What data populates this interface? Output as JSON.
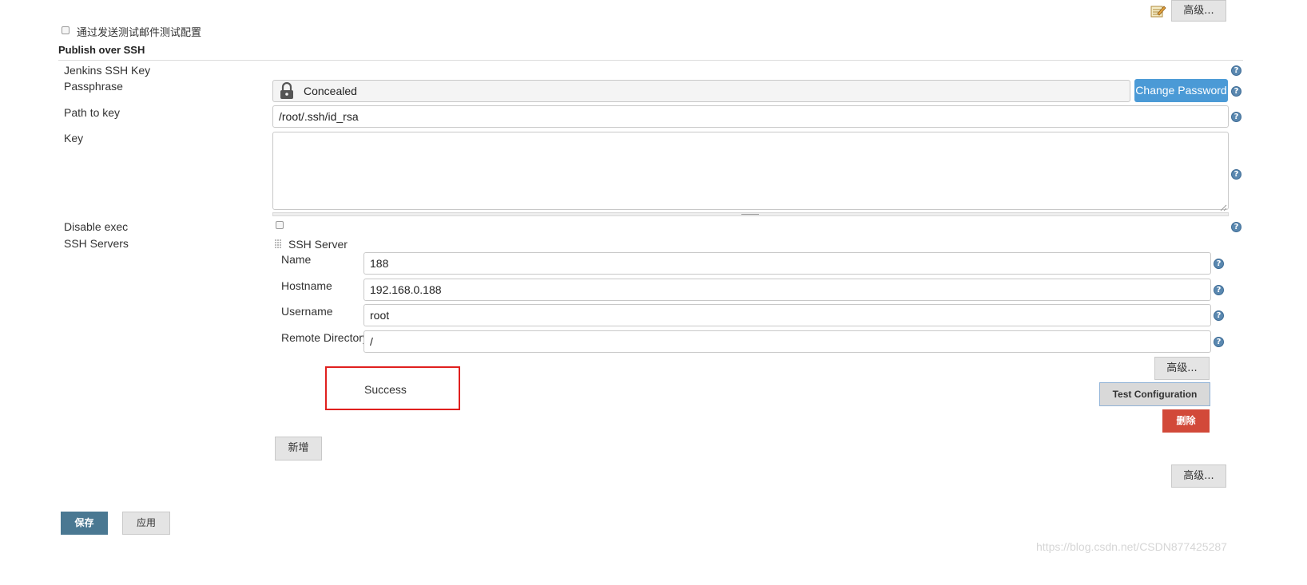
{
  "top": {
    "advanced_label": "高级..."
  },
  "email_test": {
    "checkbox_label": "通过发送测试邮件测试配置"
  },
  "section": {
    "title": "Publish over SSH"
  },
  "ssh": {
    "jenkins_key_label": "Jenkins SSH Key",
    "passphrase_label": "Passphrase",
    "passphrase_value": "Concealed",
    "change_password_label": "Change Password",
    "path_label": "Path to key",
    "path_value": "/root/.ssh/id_rsa",
    "key_label": "Key",
    "key_value": "",
    "disable_exec_label": "Disable exec",
    "servers_label": "SSH Servers"
  },
  "server": {
    "heading": "SSH Server",
    "name_label": "Name",
    "name_value": "188",
    "hostname_label": "Hostname",
    "hostname_value": "192.168.0.188",
    "username_label": "Username",
    "username_value": "root",
    "remote_dir_label": "Remote Directory",
    "remote_dir_value": "/",
    "advanced_label": "高级...",
    "test_result": "Success",
    "test_config_label": "Test Configuration",
    "delete_label": "删除"
  },
  "servers_add_label": "新增",
  "bottom_advanced_label": "高级...",
  "footer": {
    "save_label": "保存",
    "apply_label": "应用"
  },
  "watermark": "https://blog.csdn.net/CSDN877425287",
  "colors": {
    "primary_blue": "#4b9ad6",
    "save_button": "#4a7892",
    "delete_red": "#d24939",
    "highlight_red": "#e0201e"
  }
}
